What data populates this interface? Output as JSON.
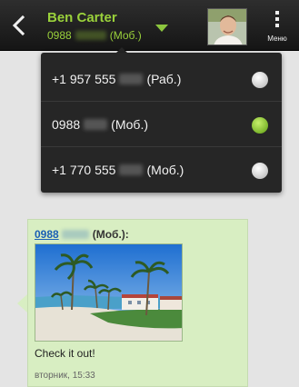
{
  "header": {
    "contact_name": "Ben Carter",
    "contact_number_prefix": "0988",
    "contact_number_type": "(Моб.)",
    "menu_label": "Меню",
    "icons": {
      "back": "chevron-left-icon",
      "expand": "chevron-down-icon",
      "menu": "overflow-menu-icon"
    }
  },
  "number_options": [
    {
      "prefix": "+1 957 555",
      "type": "(Раб.)",
      "selected": false
    },
    {
      "prefix": "0988",
      "type": "(Моб.)",
      "selected": true
    },
    {
      "prefix": "+1 770 555",
      "type": "(Моб.)",
      "selected": false
    }
  ],
  "message": {
    "sender_prefix": "0988",
    "sender_type": "(Моб.):",
    "text": "Check it out!",
    "timestamp": "вторник, 15:33"
  },
  "colors": {
    "accent_green": "#9ad13b",
    "bubble": "#d8eec2",
    "link_blue": "#1a5fb4",
    "dropdown_bg": "#262626"
  }
}
